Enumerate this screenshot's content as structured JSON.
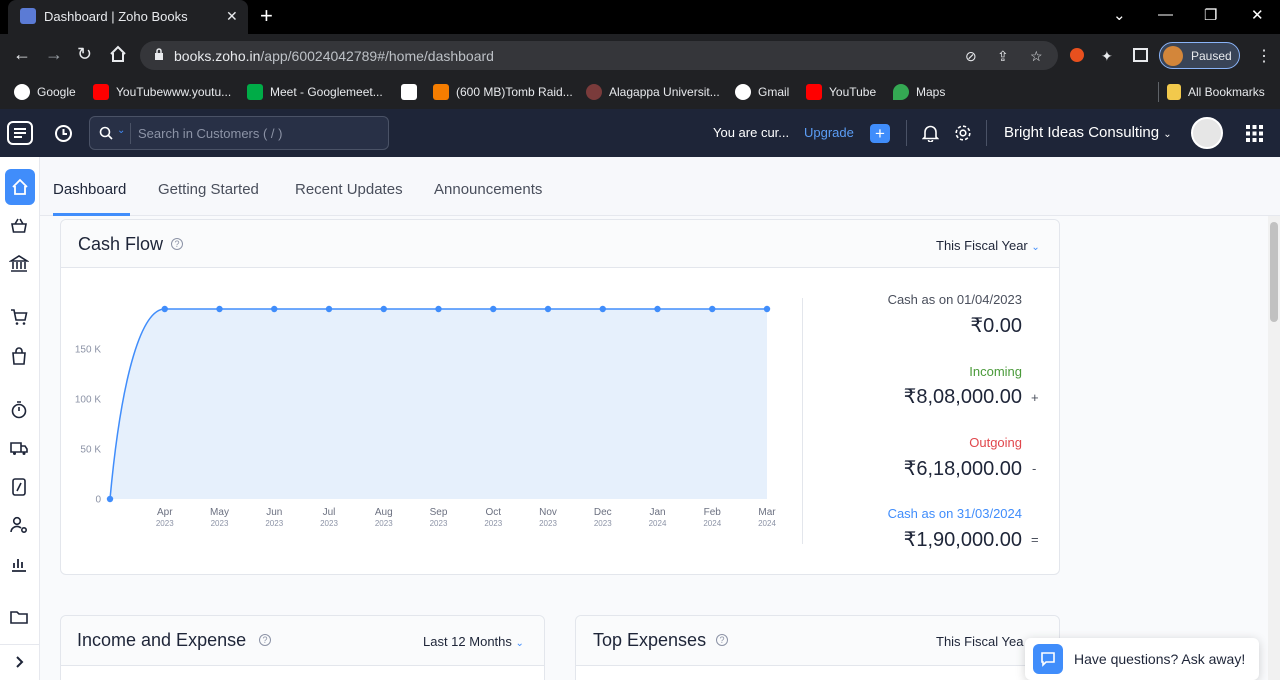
{
  "browser": {
    "tab_title": "Dashboard | Zoho Books",
    "new_tab": "+",
    "url_domain": "books.zoho.in",
    "url_path": "/app/60024042789#/home/dashboard",
    "profile_status": "Paused",
    "bookmarks": [
      {
        "label": "Google",
        "icon": "google-icon",
        "color": "#4285f4"
      },
      {
        "label": "YouTubewww.youtu...",
        "icon": "youtube-icon",
        "color": "#ff0000"
      },
      {
        "label": "Meet - Googlemeet...",
        "icon": "meet-icon",
        "color": "#00ac47"
      },
      {
        "label": "(600 MB)Tomb Raid...",
        "icon": "blogger-icon",
        "color": "#f57d00"
      },
      {
        "label": "Alagappa Universit...",
        "icon": "university-icon",
        "color": "#7a3b3b"
      },
      {
        "label": "Gmail",
        "icon": "google-icon",
        "color": "#4285f4"
      },
      {
        "label": "YouTube",
        "icon": "youtube-icon",
        "color": "#ff0000"
      },
      {
        "label": "Maps",
        "icon": "maps-icon",
        "color": "#34a853"
      }
    ],
    "all_bookmarks": "All Bookmarks"
  },
  "header": {
    "search_placeholder": "Search in Customers ( / )",
    "trial_text": "You are cur...",
    "upgrade": "Upgrade",
    "plus": "+",
    "org_name": "Bright Ideas Consulting"
  },
  "tabs": [
    "Dashboard",
    "Getting Started",
    "Recent Updates",
    "Announcements"
  ],
  "cash_flow": {
    "title": "Cash Flow",
    "help": "?",
    "filter": "This Fiscal Year",
    "opening_label": "Cash as on 01/04/2023",
    "opening_value": "₹0.00",
    "incoming_label": "Incoming",
    "incoming_value": "₹8,08,000.00",
    "incoming_op": "+",
    "outgoing_label": "Outgoing",
    "outgoing_value": "₹6,18,000.00",
    "outgoing_op": "-",
    "closing_label": "Cash as on 31/03/2024",
    "closing_value": "₹1,90,000.00",
    "closing_op": "="
  },
  "income_expense": {
    "title": "Income and Expense",
    "help": "?",
    "filter": "Last 12 Months"
  },
  "top_expenses": {
    "title": "Top Expenses",
    "help": "?",
    "filter": "This Fiscal Yea"
  },
  "help_widget": {
    "text": "Have questions? Ask away!"
  },
  "colors": {
    "accent": "#408dfb",
    "incoming": "#4a9a3a",
    "outgoing": "#e0474c",
    "closing": "#408dfb",
    "header_bg": "#1e2538"
  },
  "chart_data": {
    "type": "area",
    "x": [
      "",
      "Apr 2023",
      "May 2023",
      "Jun 2023",
      "Jul 2023",
      "Aug 2023",
      "Sep 2023",
      "Oct 2023",
      "Nov 2023",
      "Dec 2023",
      "Jan 2024",
      "Feb 2024",
      "Mar 2024"
    ],
    "x_month": [
      "",
      "Apr",
      "May",
      "Jun",
      "Jul",
      "Aug",
      "Sep",
      "Oct",
      "Nov",
      "Dec",
      "Jan",
      "Feb",
      "Mar"
    ],
    "x_year": [
      "",
      "2023",
      "2023",
      "2023",
      "2023",
      "2023",
      "2023",
      "2023",
      "2023",
      "2023",
      "2024",
      "2024",
      "2024"
    ],
    "values": [
      0,
      190000,
      190000,
      190000,
      190000,
      190000,
      190000,
      190000,
      190000,
      190000,
      190000,
      190000,
      190000
    ],
    "yticks": [
      0,
      50000,
      100000,
      150000
    ],
    "ytick_labels": [
      "0",
      "50 K",
      "100 K",
      "150 K"
    ],
    "ylim": [
      0,
      190000
    ],
    "grid": false,
    "line_color": "#408dfb",
    "fill_color": "#e6f0fc"
  }
}
